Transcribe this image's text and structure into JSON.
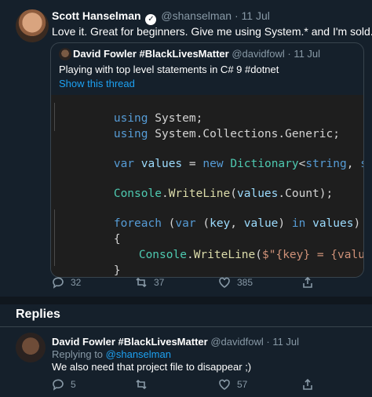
{
  "tweet": {
    "author_name": "Scott Hanselman",
    "author_handle": "@shanselman",
    "separator": "·",
    "date": "11 Jul",
    "text": "Love it. Great for beginners. Give me using System.* and I'm sold.",
    "quote": {
      "author_name": "David Fowler #BlackLivesMatter",
      "author_handle": "@davidfowl",
      "separator": "·",
      "date": "11 Jul",
      "text": "Playing with top level statements in C# 9 #dotnet",
      "show_thread": "Show this thread",
      "code": {
        "l1": [
          "using",
          " ",
          "System",
          ";"
        ],
        "l2": [
          "using",
          " ",
          "System.Collections.Generic",
          ";"
        ],
        "l3": [
          "var",
          " ",
          "values",
          " = ",
          "new",
          " ",
          "Dictionary",
          "<",
          "string",
          ", ",
          "string",
          ">();"
        ],
        "l4": [
          "Console",
          ".",
          "WriteLine",
          "(",
          "values",
          ".",
          "Count",
          ");"
        ],
        "l5": [
          "foreach",
          " (",
          "var",
          " (",
          "key",
          ", ",
          "value",
          ") ",
          "in",
          " ",
          "values",
          ")"
        ],
        "l6": [
          "{"
        ],
        "l7": [
          "Console",
          ".",
          "WriteLine",
          "(",
          "$\"{key} = {value}\"",
          ");"
        ],
        "l8": [
          "}"
        ]
      }
    },
    "actions": {
      "replies": "32",
      "retweets": "37",
      "likes": "385"
    }
  },
  "replies_section": {
    "title": "Replies"
  },
  "reply": {
    "author_name": "David Fowler #BlackLivesMatter",
    "author_handle": "@davidfowl",
    "separator": "·",
    "date": "11 Jul",
    "replying_prefix": "Replying to",
    "replying_to": "@shanselman",
    "text": "We also need that project file to disappear ;)",
    "actions": {
      "replies": "5",
      "retweets": "",
      "likes": "57"
    }
  },
  "icons": [
    "verified-badge-icon",
    "reply-icon",
    "retweet-icon",
    "like-icon",
    "share-icon"
  ]
}
